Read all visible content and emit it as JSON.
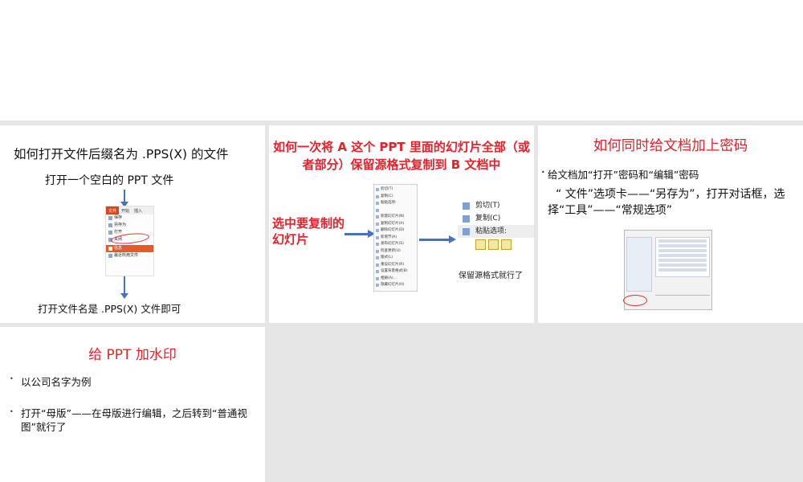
{
  "slides": [
    {
      "title": "如何打开文件后缀名为 .PPS(X) 的文件",
      "subtitle": "打开一个空白的 PPT 文件",
      "footer": "打开文件名是 .PPS(X) 文件即可",
      "menu": {
        "tabs": [
          "文件",
          "开始",
          "插入"
        ],
        "items": [
          "保存",
          "另存为",
          "打开",
          "关闭"
        ],
        "highlight": "信息",
        "recent": "最近所用文件"
      }
    },
    {
      "title": "如何一次将 A 这个 PPT 里面的幻灯片全部（或者部分）保留源格式复制到 B 文档中",
      "side_label": "选中要复制的幻灯片",
      "caption": "保留源格式就行了",
      "context_menu": [
        "剪切(T)",
        "复制(C)",
        "粘贴选项:",
        "",
        "新建幻灯片(N)",
        "复制幻灯片(A)",
        "删除幻灯片(D)",
        "新增节(A)",
        "发布幻灯片(S)",
        "检查更新(U)",
        "版式(L)",
        "重设幻灯片(R)",
        "设置背景格式(B)",
        "相册(A)...",
        "隐藏幻灯片(H)"
      ],
      "paste_panel": {
        "cut": "剪切(T)",
        "copy": "复制(C)",
        "paste": "粘贴选项:"
      }
    },
    {
      "title": "如何同时给文档加上密码",
      "bullet": "给文档加“打开”密码和“编辑”密码",
      "paragraph": "“ 文件”选项卡——“另存为”，打开对话框，选择“工具”——“常规选项”"
    },
    {
      "title": "给 PPT 加水印",
      "bullet1": "以公司名字为例",
      "bullet2": "打开“母版”——在母版进行编辑，之后转到“普通视图”就行了"
    }
  ],
  "colors": {
    "accent_red": "#e8202a",
    "arrow_blue": "#4472c4",
    "divider": "#e6e6e6"
  }
}
